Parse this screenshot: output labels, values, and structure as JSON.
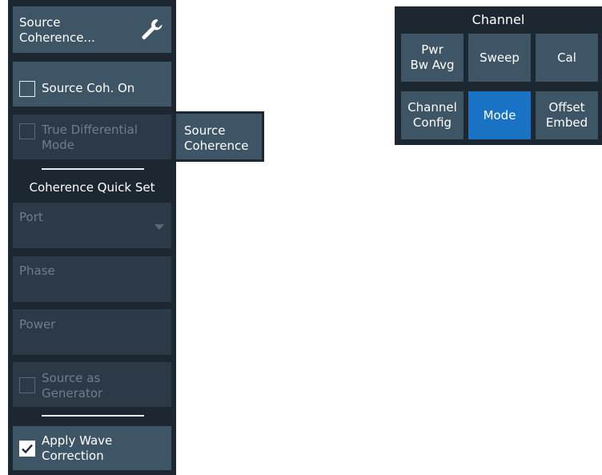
{
  "softkeys": {
    "header_line1": "Source",
    "header_line2": "Coherence...",
    "source_coh_on": "Source Coh. On",
    "true_diff_line1": "True Differential",
    "true_diff_line2": "Mode",
    "section_title": "Coherence Quick Set",
    "port": "Port",
    "phase": "Phase",
    "power": "Power",
    "src_gen_line1": "Source as",
    "src_gen_line2": "Generator",
    "apply_line1": "Apply Wave",
    "apply_line2": "Correction"
  },
  "flyout": {
    "line1": "Source",
    "line2": "Coherence"
  },
  "channel": {
    "title": "Channel",
    "buttons": [
      {
        "line1": "Pwr",
        "line2": "Bw Avg"
      },
      {
        "line1": "Sweep",
        "line2": ""
      },
      {
        "line1": "Cal",
        "line2": ""
      },
      {
        "line1": "Channel",
        "line2": "Config"
      },
      {
        "line1": "Mode",
        "line2": ""
      },
      {
        "line1": "Offset",
        "line2": "Embed"
      }
    ]
  },
  "state": {
    "source_coh_on_checked": false,
    "true_diff_checked": false,
    "src_gen_checked": false,
    "apply_checked": true,
    "active_channel_button": "Mode"
  },
  "colors": {
    "panel_bg": "#1d2731",
    "button_bg": "#3e5565",
    "disabled_bg": "#2b3a46",
    "disabled_text": "#6d7f8b",
    "active_blue": "#1a72c5"
  },
  "icons": {
    "header": "wrench-icon",
    "port_dropdown": "triangle-down-icon",
    "apply_check": "checkmark-icon"
  }
}
